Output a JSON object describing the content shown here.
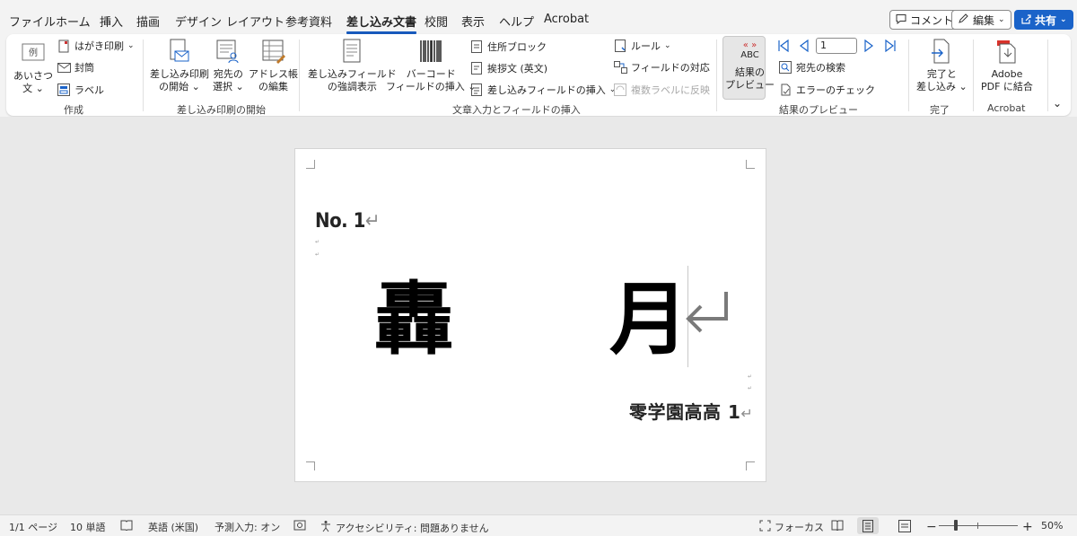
{
  "menu": {
    "tabs": [
      "ファイル",
      "ホーム",
      "挿入",
      "描画",
      "デザイン",
      "レイアウト",
      "参考資料",
      "差し込み文書",
      "校閲",
      "表示",
      "ヘルプ",
      "Acrobat"
    ],
    "active_tab": "差し込み文書",
    "comment_label": "コメント",
    "edit_label": "編集",
    "share_label": "共有"
  },
  "ribbon": {
    "create_group": {
      "greeting_label_1": "あいさつ",
      "greeting_label_2": "文",
      "greeting_icon_text": "例",
      "postcard_label": "はがき印刷",
      "envelope_label": "封筒",
      "labels_label": "ラベル",
      "group_label": "作成"
    },
    "start_group": {
      "start_merge_1": "差し込み印刷",
      "start_merge_2": "の開始",
      "select_recipients_1": "宛先の",
      "select_recipients_2": "選択",
      "edit_list_1": "アドレス帳",
      "edit_list_2": "の編集",
      "group_label": "差し込み印刷の開始"
    },
    "write_group": {
      "highlight_fields_1": "差し込みフィールド",
      "highlight_fields_2": "の強調表示",
      "barcode_1": "バーコード",
      "barcode_2": "フィールドの挿入",
      "address_block": "住所ブロック",
      "greeting_line": "挨拶文 (英文)",
      "insert_field": "差し込みフィールドの挿入",
      "rules": "ルール",
      "match_fields": "フィールドの対応",
      "update_labels": "複数ラベルに反映",
      "group_label": "文章入力とフィールドの挿入"
    },
    "preview_group": {
      "preview_icon_text": "ABC",
      "preview_1": "結果の",
      "preview_2": "プレビュー",
      "record_number": "1",
      "find_recipient": "宛先の検索",
      "check_errors": "エラーのチェック",
      "group_label": "結果のプレビュー"
    },
    "finish_group": {
      "finish_1": "完了と",
      "finish_2": "差し込み",
      "group_label": "完了"
    },
    "acrobat_group": {
      "combine_1": "Adobe",
      "combine_2": "PDF に結合",
      "group_label": "Acrobat"
    }
  },
  "document": {
    "number_label": "No. 1",
    "big_char_left": "轟",
    "big_char_right": "月",
    "school_name": "零学園高高 1"
  },
  "statusbar": {
    "page": "1/1 ページ",
    "words": "10 単語",
    "language": "英語 (米国)",
    "predict": "予測入力: オン",
    "accessibility": "アクセシビリティ: 問題ありません",
    "focus": "フォーカス",
    "zoom": "50%"
  },
  "colors": {
    "accent": "#185abd",
    "share_button": "#1a63c9"
  }
}
